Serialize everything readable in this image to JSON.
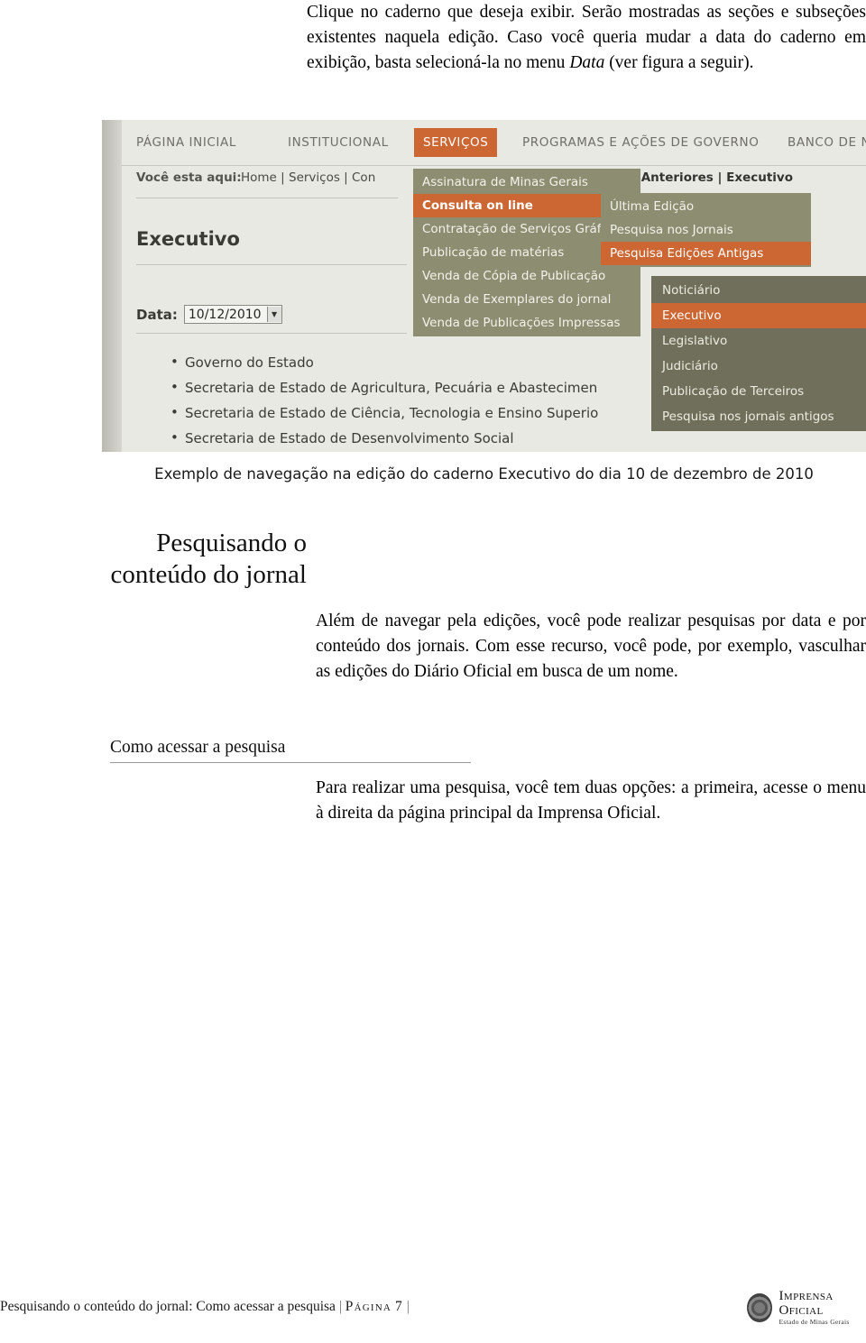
{
  "intro": {
    "text_part1": "Clique no caderno que deseja exibir. Serão mostradas as seções e subseções existentes naquela edição. Caso você queria mudar a data do caderno em exibição, basta selecioná-la no menu ",
    "text_italic": "Data",
    "text_part2": " (ver figura a seguir)."
  },
  "figure": {
    "site_nav": [
      {
        "label": "PÁGINA INICIAL",
        "active": false
      },
      {
        "label": "INSTITUCIONAL",
        "active": false
      },
      {
        "label": "SERVIÇOS",
        "active": true
      },
      {
        "label": "PROGRAMAS E AÇÕES DE GOVERNO",
        "active": false
      },
      {
        "label": "BANCO DE N",
        "active": false
      }
    ],
    "breadcrumb_label": "Você esta aqui:",
    "breadcrumb_links": "Home | Serviços | Con",
    "breadcrumb_right": "s Anteriores | Executivo",
    "page_heading": "Executivo",
    "data_label": "Data:",
    "data_value": "10/12/2010",
    "bullets": [
      "Governo do Estado",
      "Secretaria de Estado de Agricultura, Pecuária e Abastecimen",
      "Secretaria de Estado de Ciência, Tecnologia e Ensino Superio",
      "Secretaria de Estado de Desenvolvimento Social"
    ],
    "menu_column_1": [
      {
        "label": "Assinatura de Minas Gerais",
        "selected": false
      },
      {
        "label": "Consulta on line",
        "selected": true
      },
      {
        "label": "Contratação de Serviços Gráf",
        "selected": false
      },
      {
        "label": "Publicação de matérias",
        "selected": false
      },
      {
        "label": "Venda de Cópia de Publicação",
        "selected": false
      },
      {
        "label": "Venda de Exemplares do jornal",
        "selected": false
      },
      {
        "label": "Venda de Publicações Impressas",
        "selected": false
      }
    ],
    "menu_column_2": [
      {
        "label": "Última Edição",
        "selected": false
      },
      {
        "label": "Pesquisa nos Jornais",
        "selected": false
      },
      {
        "label": "Pesquisa Edições Antigas",
        "selected": true
      }
    ],
    "menu_column_3": [
      {
        "label": "Noticiário",
        "selected": false
      },
      {
        "label": "Executivo",
        "selected": true
      },
      {
        "label": "Legislativo",
        "selected": false
      },
      {
        "label": "Judiciário",
        "selected": false
      },
      {
        "label": "Publicação de Terceiros",
        "selected": false
      },
      {
        "label": "Pesquisa nos jornais antigos",
        "selected": false
      }
    ],
    "caption": "Exemplo de navegação na edição do caderno Executivo do dia 10 de dezembro de 2010"
  },
  "section": {
    "title_line1": "Pesquisando o",
    "title_line2": "conteúdo do jornal",
    "paragraph_1": "Além de navegar pela edições, você pode realizar pesquisas por data e por conteúdo dos jornais. Com esse recurso, você pode, por exemplo, vasculhar as edições do Diário Oficial em busca de um nome.",
    "subheading": "Como acessar a pesquisa",
    "paragraph_2": "Para realizar uma pesquisa, você tem duas opções: a primeira, acesse o menu à direita da página principal da Imprensa Oficial."
  },
  "footer": {
    "trail": "Pesquisando o conteúdo do jornal: Como acessar a pesquisa",
    "separator_1": "|",
    "page_word": "Página",
    "page_number": "7",
    "separator_2": "|",
    "logo_main": "Imprensa Oficial",
    "logo_sub": "Estado de Minas Gerais"
  },
  "colors": {
    "accent_orange": "#cc6633",
    "menu_olive": "#8d8d72",
    "menu_olive_dark": "#6f6f5c",
    "page_bg": "#e9e9e4"
  }
}
